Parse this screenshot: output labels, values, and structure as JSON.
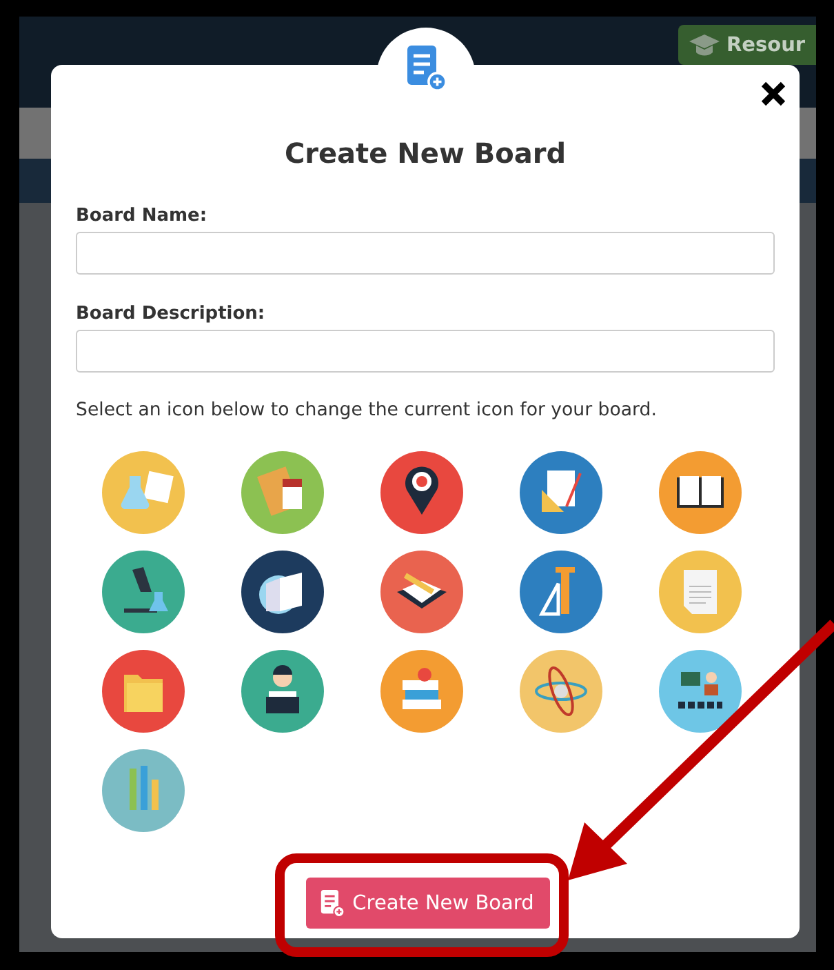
{
  "backdrop": {
    "resources_button": "Resour"
  },
  "dialog": {
    "title": "Create New Board",
    "fields": [
      {
        "label": "Board Name:"
      },
      {
        "label": "Board Description:"
      }
    ],
    "icon_hint": "Select an icon below to change the current icon for your board.",
    "icons": [
      {
        "kind": "flask",
        "color": "#f2c14e"
      },
      {
        "kind": "notebook",
        "color": "#8cc152"
      },
      {
        "kind": "map-pin",
        "color": "#e8483f"
      },
      {
        "kind": "geometry",
        "color": "#2d7fbf"
      },
      {
        "kind": "book",
        "color": "#f39c32"
      },
      {
        "kind": "microscope",
        "color": "#3bab8f"
      },
      {
        "kind": "open-book",
        "color": "#1d3b5e"
      },
      {
        "kind": "writing",
        "color": "#e9634f"
      },
      {
        "kind": "ruler",
        "color": "#2d7fbf"
      },
      {
        "kind": "paper",
        "color": "#f2c14e"
      },
      {
        "kind": "folder",
        "color": "#e8483f"
      },
      {
        "kind": "reader",
        "color": "#3bab8f"
      },
      {
        "kind": "books",
        "color": "#f39c32"
      },
      {
        "kind": "atom",
        "color": "#f2c56a"
      },
      {
        "kind": "classroom",
        "color": "#6ec6e6"
      },
      {
        "kind": "pencils",
        "color": "#7bbcc4"
      }
    ],
    "submit": "Create New Board"
  }
}
